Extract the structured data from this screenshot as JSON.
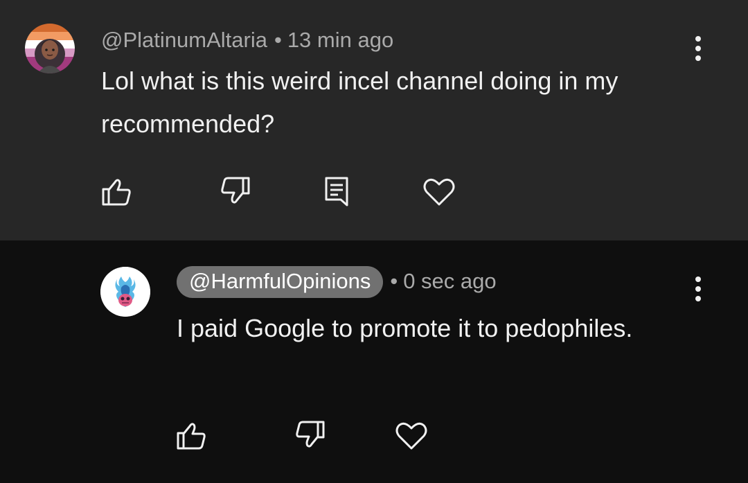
{
  "comment1": {
    "author": "@PlatinumAltaria",
    "separator": "•",
    "time": "13 min ago",
    "text": "Lol what is this weird incel channel doing in my recommended?",
    "avatar_icon": "cartoon-avatar-with-rainbow-ring",
    "actions": [
      "like-icon",
      "dislike-icon",
      "reply-icon",
      "heart-icon"
    ]
  },
  "comment2": {
    "author": "@HarmfulOpinions",
    "separator": "•",
    "time": "0 sec ago",
    "text": "I paid Google to promote it to pedophiles.",
    "avatar_icon": "blue-flame-skull-avatar",
    "actions": [
      "like-icon",
      "dislike-icon",
      "heart-icon"
    ]
  },
  "colors": {
    "comment1_bg": "#272727",
    "comment2_bg": "#0f0f0f",
    "meta_text": "#aaaaaa",
    "author_pill": "#717171",
    "body_text": "#f1f1f1"
  }
}
